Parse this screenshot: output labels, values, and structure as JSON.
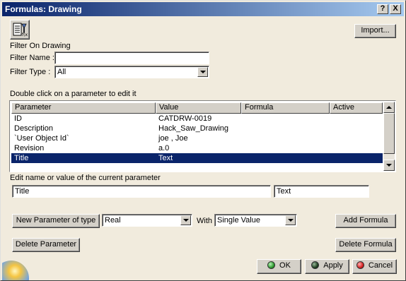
{
  "window": {
    "title": "Formulas: Drawing"
  },
  "titlebar_buttons": {
    "help": "?",
    "close": "X"
  },
  "toolbar": {
    "icon": "formula-filter-icon",
    "import_label": "Import..."
  },
  "filter": {
    "section_label": "Filter On Drawing",
    "name_label": "Filter Name :",
    "name_value": "",
    "type_label": "Filter Type :",
    "type_value": "All"
  },
  "table": {
    "caption": "Double click on a parameter to edit it",
    "columns": [
      "Parameter",
      "Value",
      "Formula",
      "Active"
    ],
    "rows": [
      {
        "parameter": "ID",
        "value": "CATDRW-0019",
        "formula": "",
        "active": ""
      },
      {
        "parameter": "Description",
        "value": "Hack_Saw_Drawing",
        "formula": "",
        "active": ""
      },
      {
        "parameter": "`User Object Id`",
        "value": "joe , Joe",
        "formula": "",
        "active": ""
      },
      {
        "parameter": "Revision",
        "value": "a.0",
        "formula": "",
        "active": ""
      },
      {
        "parameter": "Title",
        "value": "Text",
        "formula": "",
        "active": ""
      }
    ],
    "selected_row": 4
  },
  "edit": {
    "caption": "Edit name or value of the current parameter",
    "name_value": "Title",
    "value_value": "Text"
  },
  "actions": {
    "new_param_label": "New Parameter of type",
    "type_value": "Real",
    "with_label": "With",
    "with_value": "Single Value",
    "add_formula_label": "Add Formula",
    "delete_param_label": "Delete Parameter",
    "delete_formula_label": "Delete Formula"
  },
  "dialog_buttons": {
    "ok": "OK",
    "apply": "Apply",
    "cancel": "Cancel"
  },
  "colors": {
    "ok": "#2e9a2e",
    "apply": "#1f3f1f",
    "cancel": "#d42020",
    "selection": "#0a246a",
    "title_start": "#0a246a",
    "title_end": "#a6caf0"
  }
}
